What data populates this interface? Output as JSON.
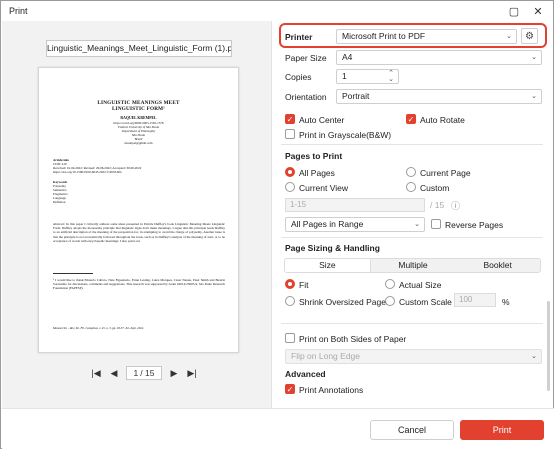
{
  "window": {
    "title": "Print"
  },
  "preview": {
    "file_name": "Linguistic_Meanings_Meet_Linguistic_Form (1).pdf",
    "page_current": "1",
    "page_total": "/ 15",
    "doc": {
      "title1": "LINGUISTIC MEANINGS MEET",
      "title2": "LINGUISTIC FORM¹",
      "author": "RAQUEL KREMPEL",
      "aff1": "https://orcid.org/0000-0003-1565-1578",
      "aff2": "Federal University of São Paulo",
      "aff3": "Department of Philosophy",
      "aff4": "São Paulo",
      "aff5": "Brazil",
      "aff6": "rkrempel@gmail.com",
      "info_head": "Article info",
      "info1": "CDD: 410",
      "info2": "Received: 01.04.2022; Revised: 29.06.2022; Accepted: 30.06.2022",
      "info3": "https://doi.org/10.1590/0100-6045.2022.V45N3.RK",
      "kw_head": "Keywords",
      "kw1": "Polysemy",
      "kw2": "Semantics",
      "kw3": "Pragmatics",
      "kw4": "Language",
      "kw5": "Deflation",
      "abstract": "Abstract: In this paper I critically address some ideas presented in Patrick Duffley's book Linguistic Meaning Meets Linguistic Form. Duffley adopts the monosemy principle that linguistic signs don't make meanings. I argue that this principle leads Duffley to an artificial description of the meaning of the preposition for, in attempting to avoid the charge of polysemy. Another issue is that the principle is not economically followed throughout the book, such as in Duffley's analysis of the meaning of start, or to be acceptance of words with encyclopedic meanings. I also point out",
      "footnote": "¹ I would like to thank Eduardo Calixto, Nate Figueiredo, Ernie Lesting, Luiza Marques, César Nauan, Peter Smith and Beatriz Sorrentino for discussions, comments and suggestions. This research was supported by Grant #2014/25605-9, São Paulo Research Foundation (FAPESP).",
      "running_foot": "Manuscrito – Rev. Int. Fil. Campinas, v. 45, n. 3, pp. 18-37, Jul.-Sept. 2022."
    }
  },
  "settings": {
    "printer_label": "Printer",
    "printer_value": "Microsoft Print to PDF",
    "paper_size_label": "Paper Size",
    "paper_size_value": "A4",
    "copies_label": "Copies",
    "copies_value": "1",
    "orientation_label": "Orientation",
    "orientation_value": "Portrait",
    "auto_center": "Auto Center",
    "auto_rotate": "Auto Rotate",
    "grayscale": "Print in Grayscale(B&W)",
    "pages_to_print_header": "Pages to Print",
    "all_pages": "All Pages",
    "current_page": "Current Page",
    "current_view": "Current View",
    "custom": "Custom",
    "range_placeholder": "1-15",
    "range_total": "/ 15",
    "range_filter": "All Pages in Range",
    "reverse_pages": "Reverse Pages",
    "sizing_header": "Page Sizing & Handling",
    "tab_size": "Size",
    "tab_multiple": "Multiple",
    "tab_booklet": "Booklet",
    "fit": "Fit",
    "actual_size": "Actual Size",
    "shrink": "Shrink Oversized Pages",
    "custom_scale": "Custom Scale",
    "scale_value": "100",
    "percent": "%",
    "both_sides": "Print on Both Sides of Paper",
    "flip_option": "Flip on Long Edge",
    "advanced_header": "Advanced",
    "print_annotations": "Print Annotations"
  },
  "footer": {
    "cancel": "Cancel",
    "print": "Print"
  },
  "colors": {
    "accent": "#e3412f",
    "highlight": "#e3412f"
  }
}
